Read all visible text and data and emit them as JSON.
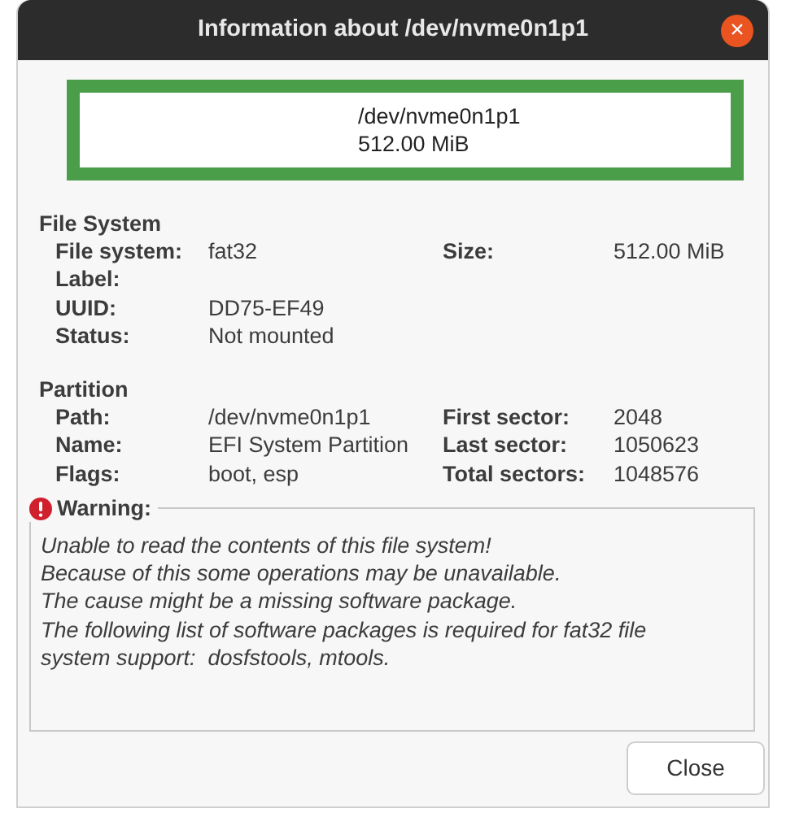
{
  "window": {
    "title": "Information about /dev/nvme0n1p1",
    "close_button": "×"
  },
  "partition_graphic": {
    "lines": [
      "/dev/nvme0n1p1",
      "512.00 MiB"
    ],
    "color": "#4a9e4a"
  },
  "sections": [
    {
      "title": "File System",
      "rows": [
        [
          {
            "label": "File system:",
            "value": "fat32"
          },
          {
            "label": "Size:",
            "value": "512.00 MiB"
          }
        ],
        [
          {
            "label": "Label:"
          }
        ],
        [
          {
            "label": "UUID:",
            "value": "DD75-EF49"
          }
        ],
        [
          {
            "label": "Status:",
            "value": "Not mounted"
          }
        ]
      ]
    },
    {
      "title": "Partition",
      "rows": [
        [
          {
            "label": "Path:",
            "value": "/dev/nvme0n1p1"
          },
          {
            "label": "First sector:",
            "value": "2048"
          }
        ],
        [
          {
            "label": "Name:",
            "value": "EFI System Partition"
          },
          {
            "label": "Last sector:",
            "value": "1050623"
          }
        ],
        [
          {
            "label": "Flags:",
            "value": "boot, esp"
          },
          {
            "label": "Total sectors:",
            "value": "1048576"
          }
        ]
      ]
    }
  ],
  "warning": {
    "title": "Warning:",
    "lines": [
      "Unable to read the contents of this file system!",
      "Because of this some operations may be unavailable.",
      "The cause might be a missing software package.",
      "The following list of software packages is required for fat32 file",
      "system support:  dosfstools, mtools."
    ]
  },
  "buttons": [
    "Close"
  ]
}
